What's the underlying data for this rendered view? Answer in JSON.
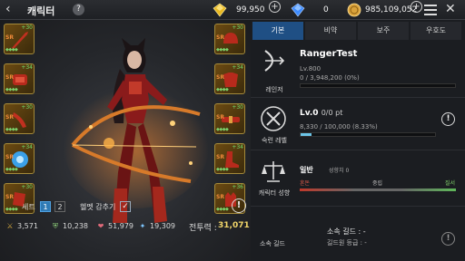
{
  "header": {
    "back_icon": "‹",
    "title": "캐릭터",
    "help_label": "?",
    "currencies": [
      {
        "icon": "gold-diamond-icon",
        "value": "99,950",
        "color": "#e8b923"
      },
      {
        "icon": "blue-diamond-icon",
        "value": "0",
        "color": "#3f8cff"
      },
      {
        "icon": "gold-coin-icon",
        "value": "985,109,052",
        "color": "#d9a23a"
      }
    ],
    "plus_label": "+",
    "close_icon": "✕"
  },
  "equipment": {
    "left_slots": [
      {
        "level": "+30",
        "grade": "SR",
        "icon": "sword-icon",
        "gems": "◆◆◆◆"
      },
      {
        "level": "+34",
        "grade": "SR",
        "icon": "gauntlet-icon",
        "gems": "◆◆◆◆"
      },
      {
        "level": "+30",
        "grade": "SR",
        "icon": "dagger-icon",
        "gems": "◆◆◆◆"
      },
      {
        "level": "+34",
        "grade": "SR",
        "icon": "crystal-icon",
        "gems": "◆◆◆◆"
      },
      {
        "level": "+30",
        "grade": "SR",
        "icon": "bracer-icon",
        "gems": "◆◆◆◆"
      }
    ],
    "right_slots": [
      {
        "level": "+30",
        "grade": "SR",
        "icon": "helmet-icon",
        "gems": "◆◆◆◆"
      },
      {
        "level": "+34",
        "grade": "SR",
        "icon": "armor-icon",
        "gems": "◆◆◆◆"
      },
      {
        "level": "+30",
        "grade": "SR",
        "icon": "belt-icon",
        "gems": "◆◆◆◆"
      },
      {
        "level": "+34",
        "grade": "SR",
        "icon": "boots-icon",
        "gems": "◆◆◆◆"
      },
      {
        "level": "+36",
        "grade": "SR",
        "icon": "gloves-icon",
        "gems": "◆◆◆◆"
      }
    ]
  },
  "controls": {
    "set_label": "세트",
    "set_1": "1",
    "set_2": "2",
    "helmet_label": "헬멧 감추기",
    "helmet_checked": "✓",
    "info_label": "!"
  },
  "stats": {
    "attack": "3,571",
    "defense": "10,238",
    "hp": "51,979",
    "crit": "19,309",
    "power_label": "전투력 :",
    "power_value": "31,071"
  },
  "tabs": [
    {
      "label": "기본",
      "active": true
    },
    {
      "label": "비약",
      "active": false
    },
    {
      "label": "보주",
      "active": false
    },
    {
      "label": "우호도",
      "active": false
    }
  ],
  "profile": {
    "class_label": "레인저",
    "name": "RangerTest",
    "level": "Lv.800",
    "exp": "0 / 3,948,200 (0%)"
  },
  "mastery": {
    "label": "숙련 레벨",
    "level": "Lv.0",
    "points": "0/0 pt",
    "exp": "8,330 / 100,000 (8.33%)",
    "progress": 0.0833
  },
  "tendency": {
    "label": "캐릭터 성향",
    "name": "일반",
    "sub": "성향치 0",
    "left": "혼돈",
    "middle": "중립",
    "right": "질서"
  },
  "guild": {
    "label": "소속 길드",
    "name_line": "소속 길드 : -",
    "rank_line": "길드원 등급 : -"
  }
}
